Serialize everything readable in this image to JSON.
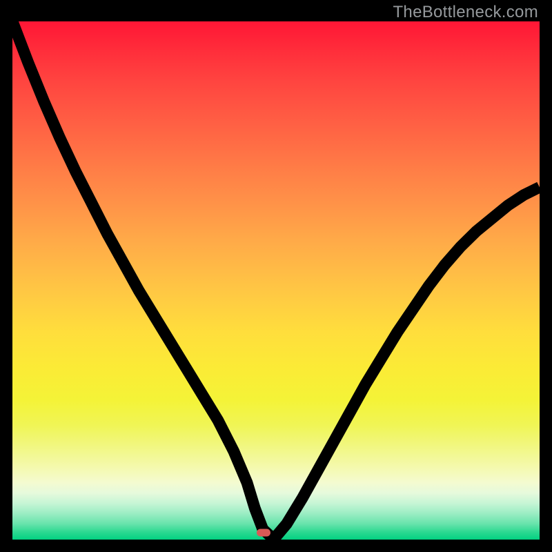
{
  "watermark": "TheBottleneck.com",
  "marker": {
    "color": "#d85a56",
    "x_pct": 47.6,
    "y_pct": 98.7
  },
  "chart_data": {
    "type": "line",
    "title": "",
    "xlabel": "",
    "ylabel": "",
    "xlim": [
      0,
      100
    ],
    "ylim": [
      0,
      100
    ],
    "annotations": [],
    "series": [
      {
        "name": "bottleneck-curve",
        "x": [
          0,
          3,
          6,
          9,
          12,
          15,
          18,
          21,
          24,
          27,
          30,
          33,
          36,
          39,
          42,
          44.5,
          46,
          47.5,
          49,
          50,
          52,
          55,
          58,
          61,
          64,
          67,
          70,
          73,
          76,
          79,
          82,
          85,
          88,
          91,
          94,
          97,
          100
        ],
        "y": [
          100,
          92,
          84.5,
          77.5,
          71,
          65,
          59,
          53.5,
          48,
          43,
          38,
          33,
          28,
          23,
          17,
          11,
          6,
          2,
          0.6,
          0.6,
          3,
          8,
          13.5,
          19,
          24.5,
          30,
          35,
          40,
          44.5,
          49,
          53,
          56.5,
          59.5,
          62,
          64.5,
          66.5,
          68
        ]
      }
    ]
  }
}
